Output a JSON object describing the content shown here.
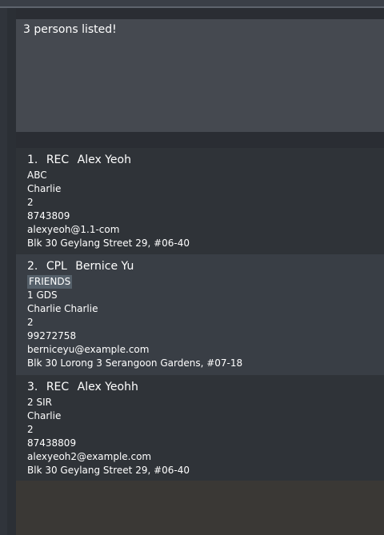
{
  "result": {
    "message": "3 persons listed!"
  },
  "persons": [
    {
      "index": "1.",
      "category": "REC",
      "name": "Alex Yeoh",
      "tags": [],
      "lines": [
        "ABC",
        "Charlie",
        "2",
        "8743809",
        "alexyeoh@1.1-com",
        "Blk 30 Geylang Street 29, #06-40"
      ]
    },
    {
      "index": "2.",
      "category": "CPL",
      "name": "Bernice Yu",
      "tags": [
        "FRIENDS"
      ],
      "lines": [
        "1 GDS",
        "Charlie Charlie",
        "2",
        "99272758",
        "berniceyu@example.com",
        "Blk 30 Lorong 3 Serangoon Gardens, #07-18"
      ]
    },
    {
      "index": "3.",
      "category": "REC",
      "name": "Alex Yeohh",
      "tags": [],
      "lines": [
        "2 SIR",
        "Charlie",
        "2",
        "87438809",
        "alexyeoh2@example.com",
        "Blk 30 Geylang Street 29, #06-40"
      ]
    }
  ]
}
